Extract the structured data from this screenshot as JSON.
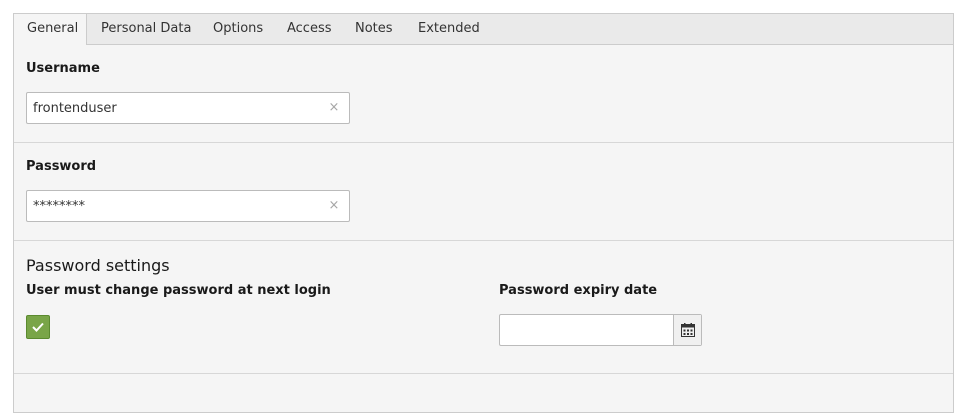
{
  "tabs": [
    {
      "label": "General",
      "active": true
    },
    {
      "label": "Personal Data",
      "active": false
    },
    {
      "label": "Options",
      "active": false
    },
    {
      "label": "Access",
      "active": false
    },
    {
      "label": "Notes",
      "active": false
    },
    {
      "label": "Extended",
      "active": false
    }
  ],
  "username": {
    "label": "Username",
    "value": "frontenduser",
    "clear_icon": "×"
  },
  "password": {
    "label": "Password",
    "value": "********",
    "clear_icon": "×"
  },
  "password_settings": {
    "heading": "Password settings",
    "change_next_login": {
      "label": "User must change password at next login",
      "checked": true
    },
    "expiry_date": {
      "label": "Password expiry date",
      "value": ""
    }
  },
  "colors": {
    "checkbox_checked": "#79a548",
    "panel_background": "#f5f5f5",
    "tab_bar_background": "#eaeaea"
  },
  "icons": {
    "checkbox": "check-icon",
    "date": "calendar-icon",
    "clear": "close-icon"
  }
}
